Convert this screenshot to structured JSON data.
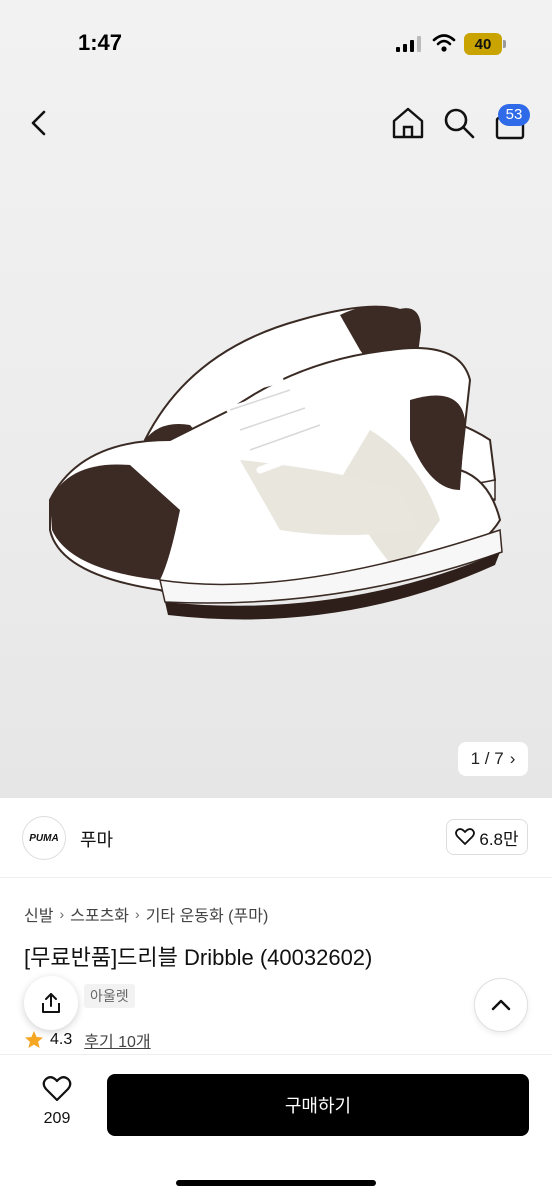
{
  "status_bar": {
    "time": "1:47",
    "battery": "40"
  },
  "nav": {
    "cart_count": "53"
  },
  "gallery": {
    "pager": "1 / 7"
  },
  "brand": {
    "name": "푸마",
    "logo_text": "PUMA",
    "likes": "6.8만"
  },
  "breadcrumb": [
    "신발",
    "스포츠화",
    "기타 운동화 (푸마)"
  ],
  "product": {
    "title": "[무료반품]드리블 Dribble (40032602)",
    "tag": "아울렛",
    "rating": "4.3",
    "reviews": "후기 10개"
  },
  "bottom": {
    "wish_count": "209",
    "buy_label": "구매하기"
  },
  "colors": {
    "accent_blue": "#2f6ae8",
    "star": "#f5a623",
    "buy_bg": "#000000"
  }
}
